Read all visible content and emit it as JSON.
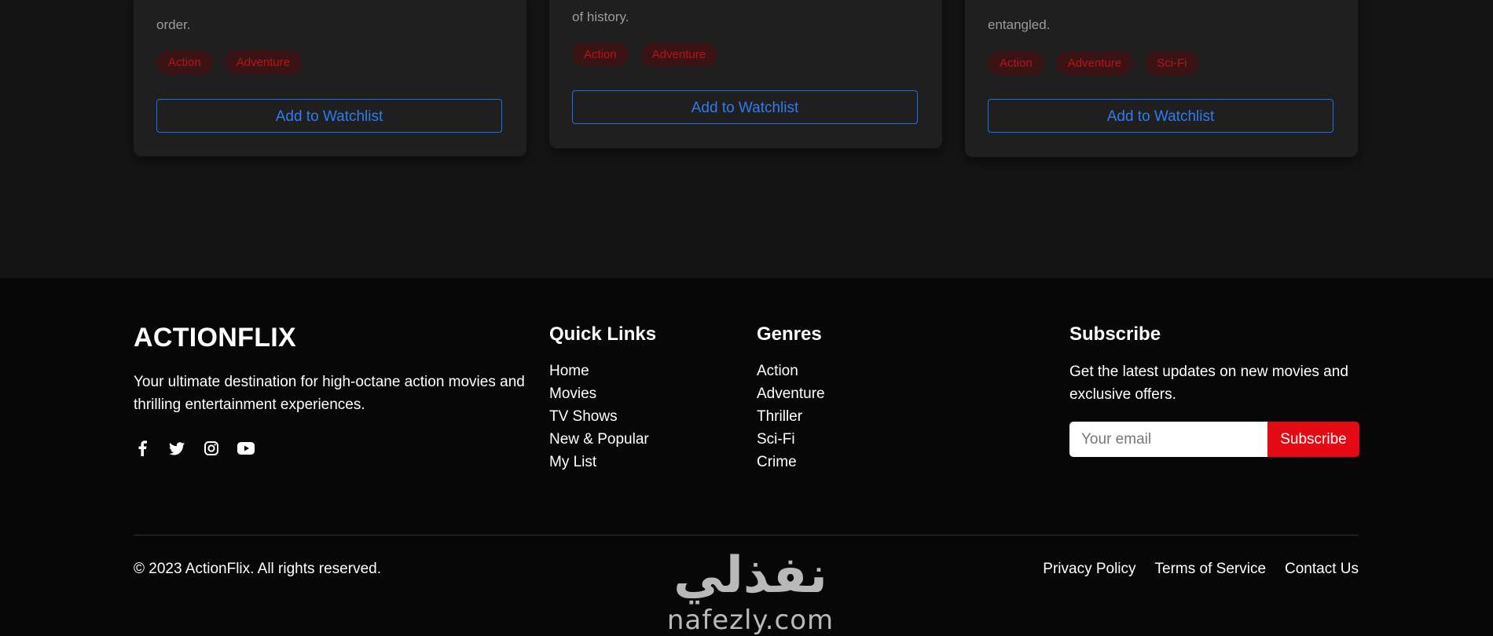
{
  "cards": [
    {
      "desc_tail": "order.",
      "tags": [
        "Action",
        "Adventure"
      ],
      "watchlist_label": "Add to Watchlist"
    },
    {
      "desc_tail": "of history.",
      "tags": [
        "Action",
        "Adventure"
      ],
      "watchlist_label": "Add to Watchlist"
    },
    {
      "desc_tail": "entangled.",
      "tags": [
        "Action",
        "Adventure",
        "Sci-Fi"
      ],
      "watchlist_label": "Add to Watchlist"
    }
  ],
  "footer": {
    "brand": "ACTIONFLIX",
    "brand_desc": "Your ultimate destination for high-octane action movies and thrilling entertainment experiences.",
    "socials": [
      "facebook-icon",
      "twitter-icon",
      "instagram-icon",
      "youtube-icon"
    ],
    "quick_links": {
      "title": "Quick Links",
      "items": [
        "Home",
        "Movies",
        "TV Shows",
        "New & Popular",
        "My List"
      ]
    },
    "genres": {
      "title": "Genres",
      "items": [
        "Action",
        "Adventure",
        "Thriller",
        "Sci-Fi",
        "Crime"
      ]
    },
    "subscribe": {
      "title": "Subscribe",
      "desc": "Get the latest updates on new movies and exclusive offers.",
      "placeholder": "Your email",
      "button": "Subscribe"
    },
    "copyright": "© 2023 ActionFlix. All rights reserved.",
    "legal": [
      "Privacy Policy",
      "Terms of Service",
      "Contact Us"
    ]
  },
  "watermark": {
    "arabic": "نفذلي",
    "latin": "nafezly.com"
  },
  "colors": {
    "accent_red": "#e50914",
    "watchlist_blue": "#2f7cf0",
    "tag_text": "#b8121b"
  }
}
